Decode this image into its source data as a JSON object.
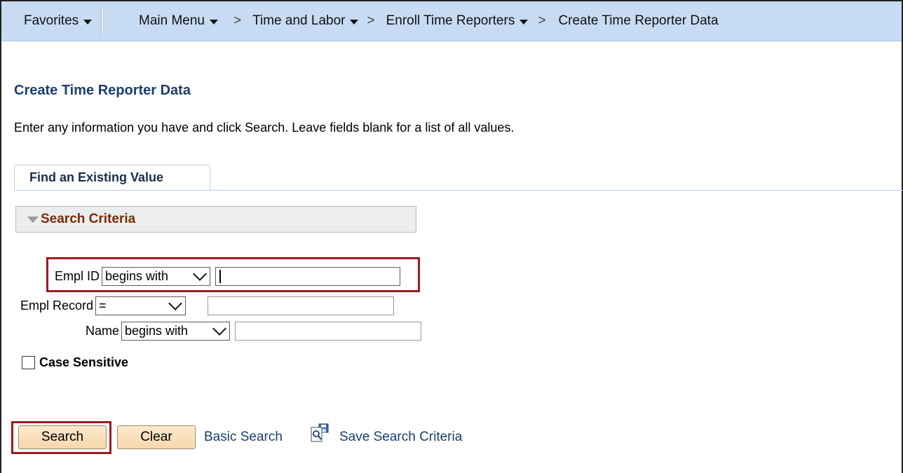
{
  "nav": {
    "favorites": "Favorites",
    "main_menu": "Main Menu",
    "sep1": ">",
    "time_labor": "Time and Labor",
    "sep2": ">",
    "enroll": "Enroll Time Reporters",
    "sep3": ">",
    "current": "Create Time Reporter Data"
  },
  "page": {
    "title": "Create Time Reporter Data",
    "instructions": "Enter any information you have and click Search. Leave fields blank for a list of all values."
  },
  "tab": {
    "label": "Find an Existing Value"
  },
  "search_criteria": {
    "label": "Search Criteria",
    "fields": [
      {
        "label": "Empl ID",
        "operator": "begins with",
        "value": ""
      },
      {
        "label": "Empl Record",
        "operator": "=",
        "value": ""
      },
      {
        "label": "Name",
        "operator": "begins with",
        "value": ""
      }
    ],
    "case_sensitive_label": "Case Sensitive",
    "case_sensitive_checked": false
  },
  "actions": {
    "search": "Search",
    "clear": "Clear",
    "basic_search": "Basic Search",
    "save_criteria": "Save Search Criteria"
  },
  "colors": {
    "navbar": "#c7dcf2",
    "title": "#1b3f6e",
    "criteria_header": "#7a2d05",
    "highlight": "#9b1b22",
    "button": "#f7d7ab"
  }
}
